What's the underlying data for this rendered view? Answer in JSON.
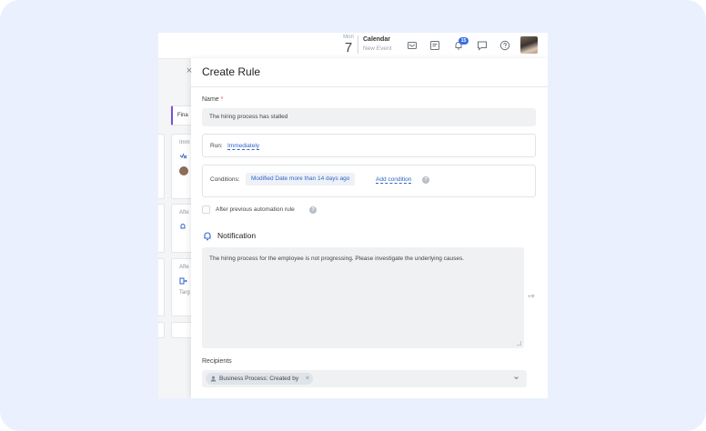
{
  "header": {
    "date_dow": "Mon",
    "date_day": "7",
    "calendar_title": "Calendar",
    "calendar_sub": "New Event",
    "notification_count": "15"
  },
  "left_pane": {
    "tab_label": "Fina",
    "card1_label": "Imm",
    "card2_label": "Afte",
    "card3_label": "Afte",
    "card3_sub": "Targ"
  },
  "panel": {
    "title": "Create Rule",
    "name_label": "Name",
    "name_required": "*",
    "name_value": "The hiring process has stalled",
    "run_label": "Run:",
    "run_value": "Immediately",
    "conditions_label": "Conditions:",
    "condition_chip": "Modified Date more than 14 days ago",
    "add_condition": "Add condition",
    "help_glyph": "?",
    "after_previous": "After previous automation rule",
    "notification_title": "Notification",
    "message": "The hiring process for the employee is not progressing. Please investigate the underlying causes.",
    "add_var": "+≡",
    "recipients_label": "Recipients",
    "recipient_chip": "Business Process: Created by",
    "remove_glyph": "×",
    "close_glyph": "×"
  },
  "colors": {
    "accent": "#2f63c8",
    "badge": "#3b6fe0",
    "outer_bg": "#eaf0fd",
    "tab_accent": "#7b4fd6"
  }
}
